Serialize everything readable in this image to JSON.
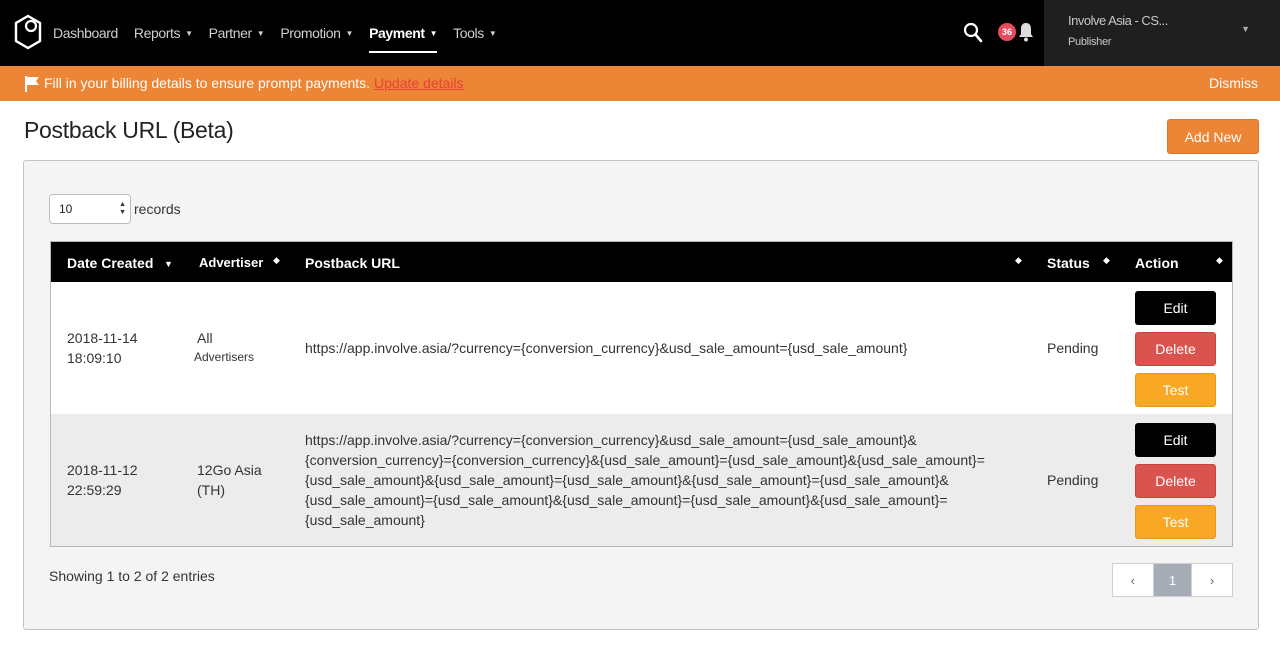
{
  "nav": {
    "items": [
      {
        "label": "Dashboard",
        "caret": false,
        "active": false
      },
      {
        "label": "Reports",
        "caret": true,
        "active": false
      },
      {
        "label": "Partner",
        "caret": true,
        "active": false
      },
      {
        "label": "Promotion",
        "caret": true,
        "active": false
      },
      {
        "label": "Payment",
        "caret": true,
        "active": true
      },
      {
        "label": "Tools",
        "caret": true,
        "active": false
      }
    ],
    "notification_count": "36",
    "user": {
      "name": "Involve Asia - CS...",
      "role": "Publisher"
    }
  },
  "banner": {
    "text": "Fill in your billing details to ensure prompt payments.",
    "link": "Update details",
    "dismiss": "Dismiss"
  },
  "page": {
    "title": "Postback URL (Beta)",
    "add_new": "Add New",
    "records_value": "10",
    "records_label": "records"
  },
  "table": {
    "headers": {
      "date_created": "Date Created",
      "advertiser": "Advertiser",
      "postback_url": "Postback URL",
      "status": "Status",
      "action": "Action"
    },
    "rows": [
      {
        "date": "2018-11-14",
        "time": "18:09:10",
        "advertiser_line1": "All",
        "advertiser_line2": "Advertisers",
        "url_lines": [
          "https://app.involve.asia/?currency={conversion_currency}&usd_sale_amount={usd_sale_amount}"
        ],
        "status": "Pending"
      },
      {
        "date": "2018-11-12",
        "time": "22:59:29",
        "advertiser_line1": "12Go Asia",
        "advertiser_line2": "(TH)",
        "url_lines": [
          "https://app.involve.asia/?currency={conversion_currency}&usd_sale_amount={usd_sale_amount}&",
          "{conversion_currency}={conversion_currency}&{usd_sale_amount}={usd_sale_amount}&{usd_sale_amount}=",
          "{usd_sale_amount}&{usd_sale_amount}={usd_sale_amount}&{usd_sale_amount}={usd_sale_amount}&",
          "{usd_sale_amount}={usd_sale_amount}&{usd_sale_amount}={usd_sale_amount}&{usd_sale_amount}=",
          "{usd_sale_amount}"
        ],
        "status": "Pending"
      }
    ],
    "actions": {
      "edit": "Edit",
      "delete": "Delete",
      "test": "Test"
    }
  },
  "footer": {
    "showing": "Showing 1 to 2 of 2 entries",
    "pager": {
      "prev": "‹",
      "current": "1",
      "next": "›"
    }
  }
}
